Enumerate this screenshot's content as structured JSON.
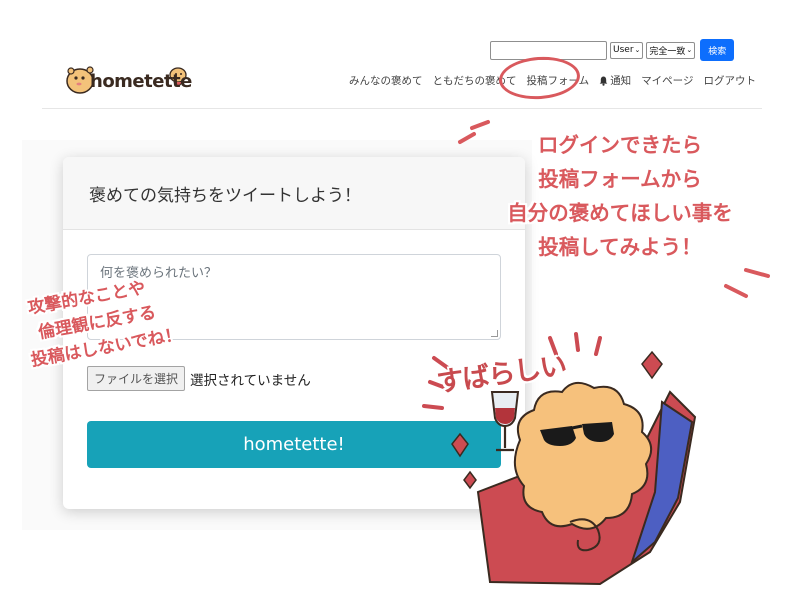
{
  "header": {
    "search": {
      "value": "",
      "placeholder": ""
    },
    "select_type": "User",
    "select_match": "完全一致",
    "search_button": "検索",
    "logo_text": "hometette",
    "nav": {
      "everyone": "みんなの褒めて",
      "friends": "ともだちの褒めて",
      "post_form": "投稿フォーム",
      "notifications": "通知",
      "mypage": "マイページ",
      "logout": "ログアウト"
    }
  },
  "card": {
    "title": "褒めての気持ちをツイートしよう！",
    "textarea_placeholder": "何を褒められたい？",
    "file_button": "ファイルを選択",
    "file_status": "選択されていません",
    "submit": "hometette!"
  },
  "overlay": {
    "callout": [
      "ログインできたら",
      "投稿フォームから",
      "自分の褒めてほしい事を",
      "投稿してみよう！"
    ],
    "warning": [
      "攻撃的なことや",
      "倫理観に反する",
      "投稿はしないでね！"
    ],
    "mascot_text": "すばらしい"
  },
  "colors": {
    "accent_red": "#d9595d",
    "submit_teal": "#17a2b8",
    "search_blue": "#0d6efd"
  }
}
